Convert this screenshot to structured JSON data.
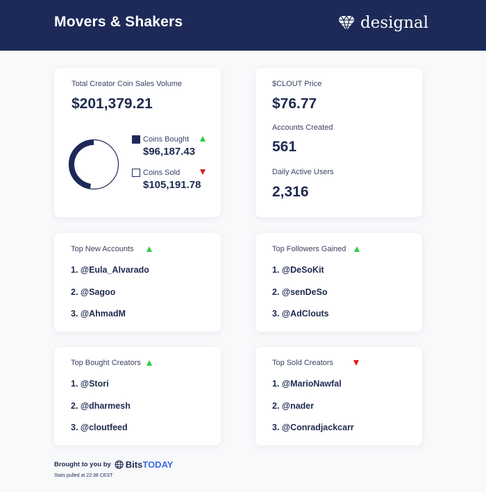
{
  "header": {
    "title": "Movers & Shakers",
    "brand": "designal"
  },
  "colors": {
    "navy": "#1d2a58",
    "up": "#2ecc40",
    "down": "#d81c1c",
    "accent": "#3c6be0"
  },
  "sales": {
    "label": "Total Creator Coin Sales Volume",
    "total": "$201,379.21",
    "bought_share": 0.477,
    "bought": {
      "label": "Coins Bought",
      "value": "$96,187.43",
      "trend": "up"
    },
    "sold": {
      "label": "Coins Sold",
      "value": "$105,191.78",
      "trend": "down"
    }
  },
  "stats": {
    "price_label": "$CLOUT Price",
    "price": "$76.77",
    "accounts_label": "Accounts Created",
    "accounts": "561",
    "dau_label": "Daily Active Users",
    "dau": "2,316"
  },
  "top_new_accounts": {
    "title": "Top New Accounts",
    "trend": "up",
    "items": [
      "1. @Eula_Alvarado",
      "2. @Sagoo",
      "3. @AhmadM"
    ]
  },
  "top_followers": {
    "title": "Top Followers Gained",
    "trend": "up",
    "items": [
      "1. @DeSoKit",
      "2. @senDeSo",
      "3. @AdClouts"
    ]
  },
  "top_bought": {
    "title": "Top Bought Creators",
    "trend": "up",
    "items": [
      "1. @Stori",
      "2. @dharmesh",
      "3. @cloutfeed"
    ]
  },
  "top_sold": {
    "title": "Top Sold Creators",
    "trend": "down",
    "items": [
      "1. @MarioNawfal",
      "2. @nader",
      "3. @Conradjackcarr"
    ]
  },
  "footer": {
    "brought_by": "Brought to you by",
    "brand_bits": "Bits",
    "brand_today": "TODAY",
    "stats_note": "Stats pulled at 22:38 CEST"
  },
  "icons": {
    "brand": "diamond-icon",
    "footer": "globe-icon",
    "trend_up": "triangle-up-icon",
    "trend_down": "triangle-down-icon"
  }
}
